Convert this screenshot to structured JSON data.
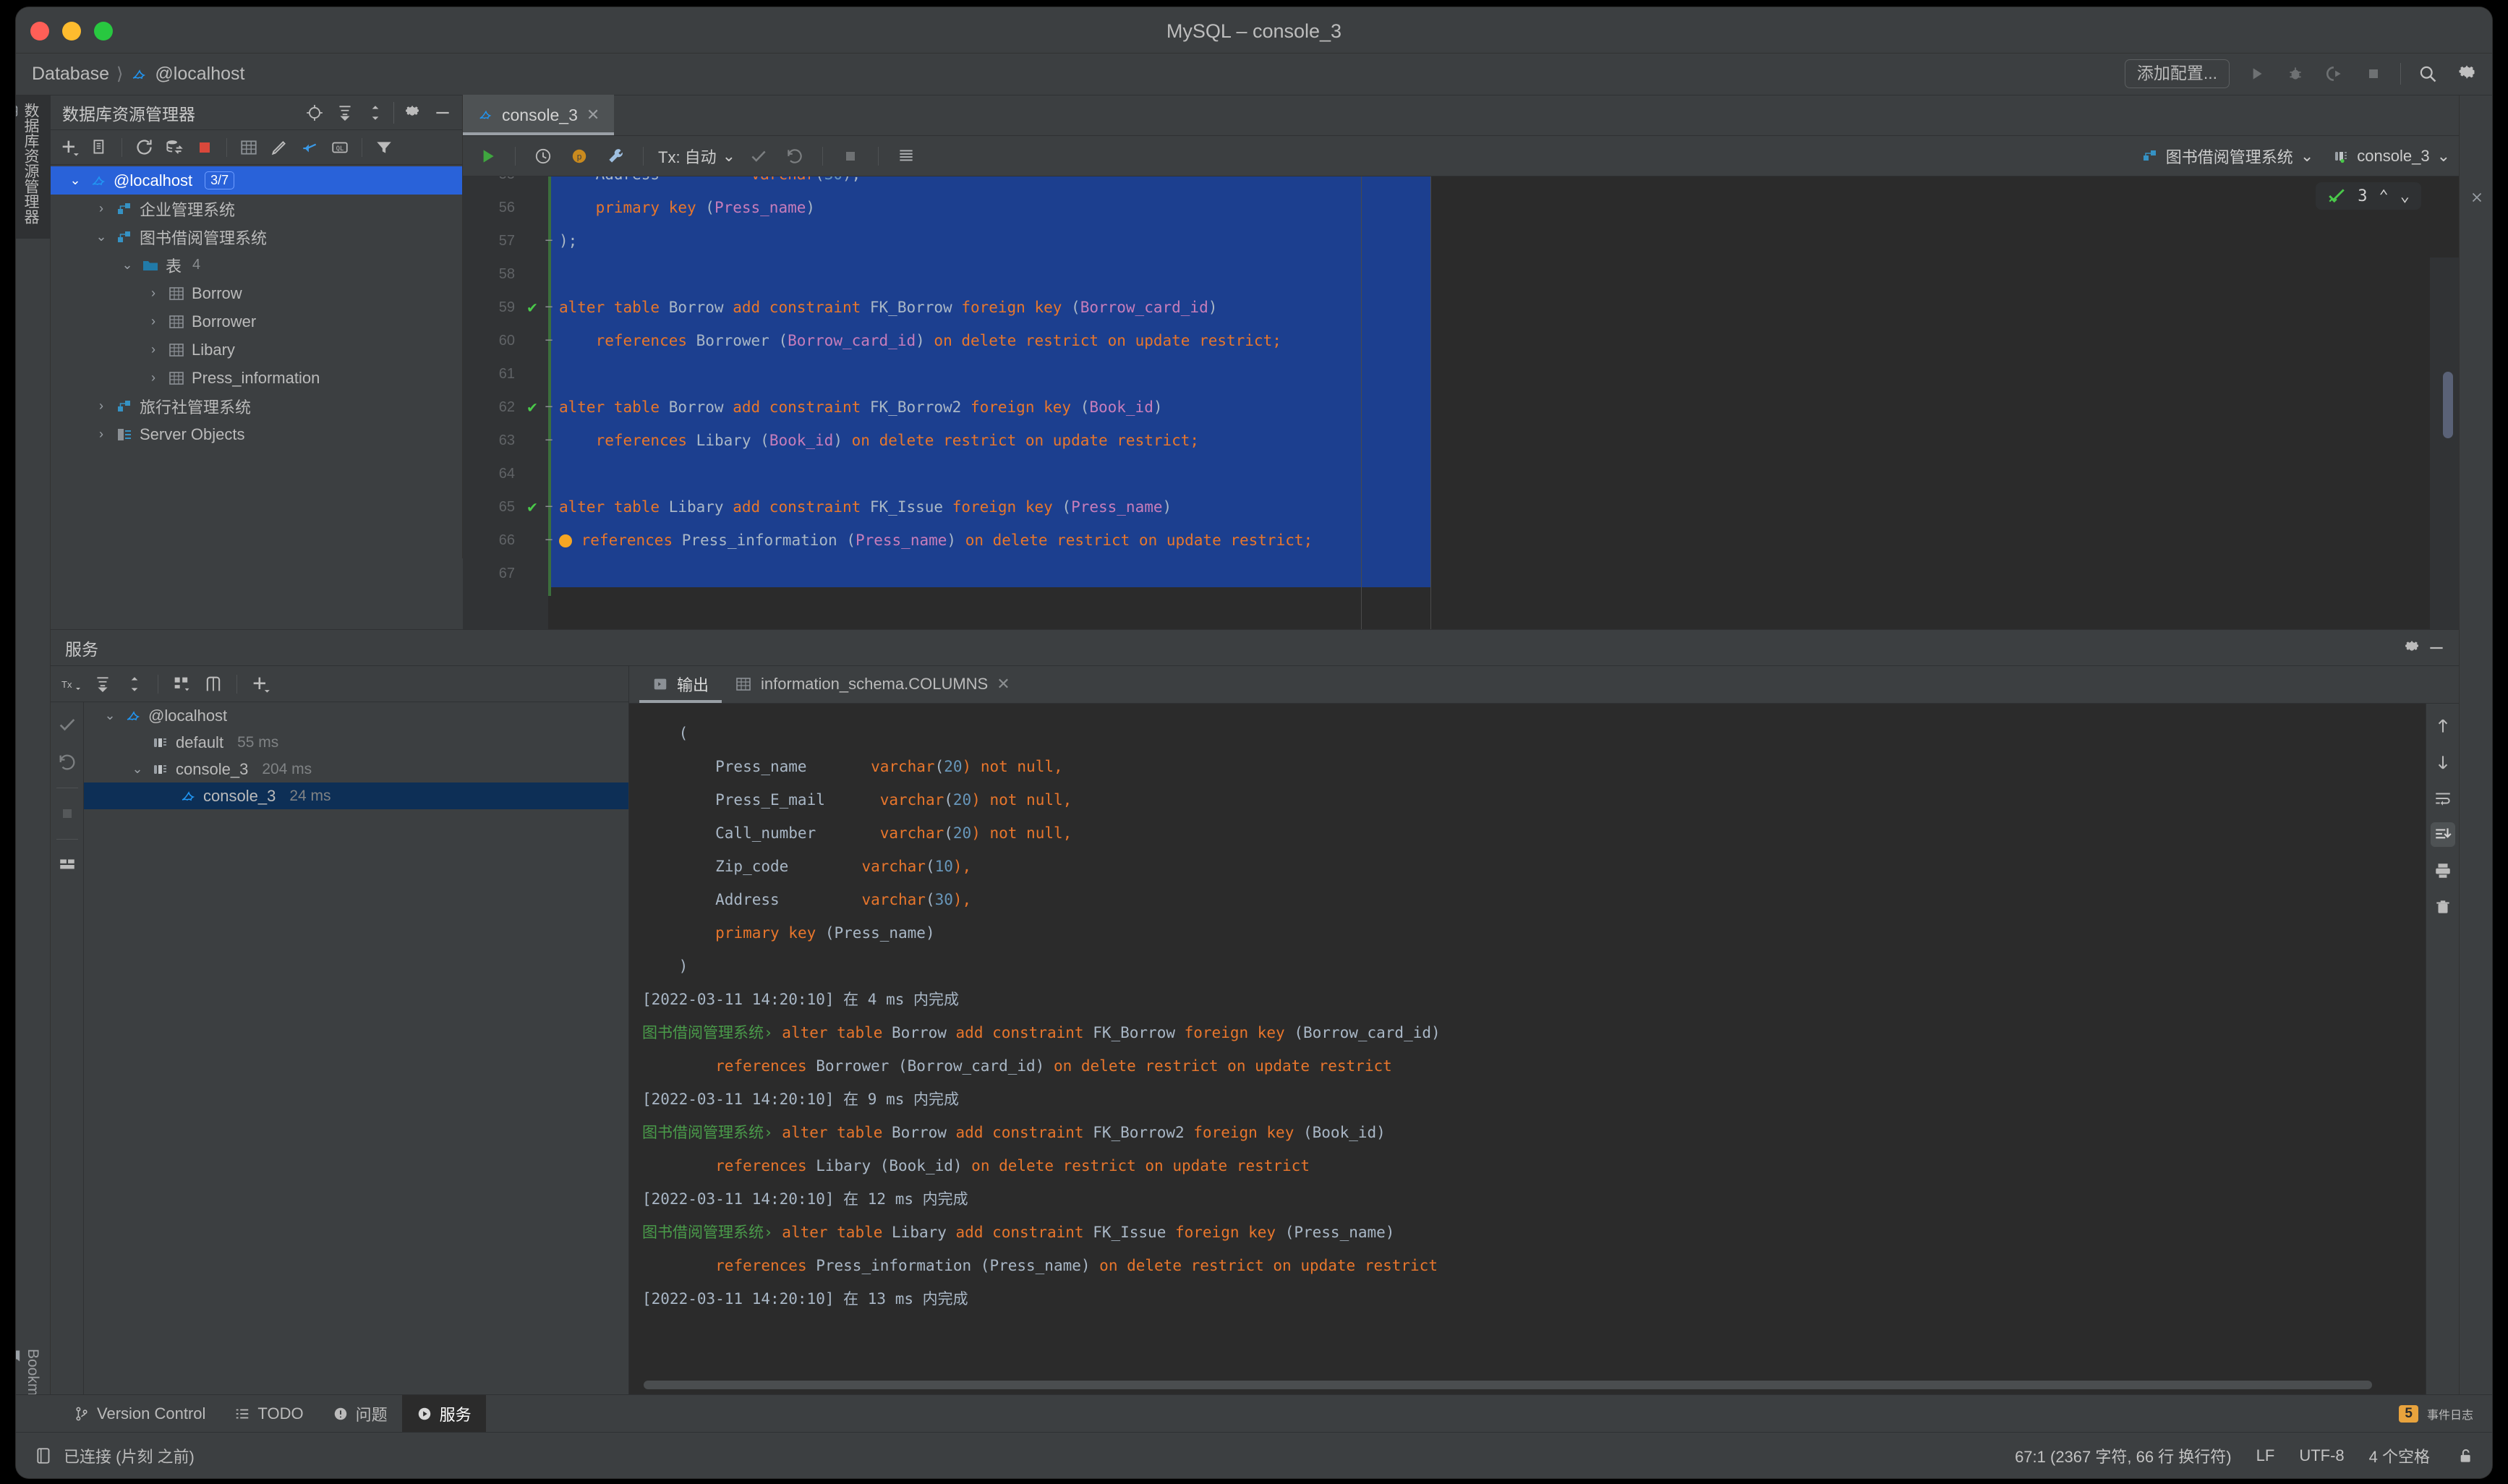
{
  "window": {
    "title": "MySQL – console_3",
    "traffic_lights": [
      "close",
      "minimize",
      "zoom"
    ]
  },
  "navbar": {
    "breadcrumb": [
      "Database",
      "@localhost"
    ],
    "add_config_label": "添加配置...",
    "icons": [
      "run-icon",
      "debug-icon",
      "run-with-coverage-icon",
      "stop-icon",
      "search-icon",
      "gear-icon"
    ]
  },
  "db_explorer": {
    "vertical_tab_label": "数据库资源管理器",
    "title": "数据库资源管理器",
    "header_icons": [
      "locate-icon",
      "expand-all-icon",
      "collapse-all-icon",
      "gear-icon",
      "minimize-icon"
    ],
    "toolbar_icons": [
      "add-icon",
      "copy-icon",
      "refresh-icon",
      "sync-icon",
      "stop-icon",
      "table-icon",
      "edit-icon",
      "jump-to-icon",
      "query-console-icon",
      "filter-icon"
    ],
    "tree": [
      {
        "label": "@localhost",
        "badge": "3/7",
        "icon": "mysql-icon",
        "level": 0,
        "expanded": true,
        "selected": true
      },
      {
        "label": "企业管理系统",
        "icon": "schema-icon",
        "level": 1,
        "expanded": false,
        "selected": false
      },
      {
        "label": "图书借阅管理系统",
        "icon": "schema-icon",
        "level": 1,
        "expanded": true,
        "selected": false
      },
      {
        "label": "表",
        "count": "4",
        "icon": "folder-icon",
        "level": 2,
        "expanded": true,
        "selected": false
      },
      {
        "label": "Borrow",
        "icon": "table-icon",
        "level": 3,
        "expanded": false,
        "selected": false
      },
      {
        "label": "Borrower",
        "icon": "table-icon",
        "level": 3,
        "expanded": false,
        "selected": false
      },
      {
        "label": "Libary",
        "icon": "table-icon",
        "level": 3,
        "expanded": false,
        "selected": false
      },
      {
        "label": "Press_information",
        "icon": "table-icon",
        "level": 3,
        "expanded": false,
        "selected": false
      },
      {
        "label": "旅行社管理系统",
        "icon": "schema-icon",
        "level": 1,
        "expanded": false,
        "selected": false
      },
      {
        "label": "Server Objects",
        "icon": "server-objects-icon",
        "level": 1,
        "expanded": false,
        "selected": false
      }
    ]
  },
  "editor": {
    "tab": {
      "label": "console_3",
      "icon": "mysql-icon",
      "close": "✕"
    },
    "toolbar": {
      "run_icon": "run-icon",
      "history_icon": "history-icon",
      "params_icon": "parameters-icon",
      "wrench_icon": "wrench-icon",
      "tx_label": "Tx: 自动",
      "commit_icon": "commit-icon",
      "rollback_icon": "rollback-icon",
      "stop_icon": "stop-icon",
      "grid_icon": "data-grid-icon",
      "schema_selector": "图书借阅管理系统",
      "session_selector": "console_3"
    },
    "inspection_widget": {
      "count": "3",
      "up": "⌃",
      "down": "⌄"
    },
    "lines": [
      {
        "num": "55",
        "partial": true,
        "mark": "",
        "fold": "",
        "tokens": [
          {
            "t": "    Address          ",
            "c": "id"
          },
          {
            "t": "varchar",
            "c": "kw"
          },
          {
            "t": "(",
            "c": "plain"
          },
          {
            "t": "30",
            "c": "num2"
          },
          {
            "t": "),",
            "c": "plain"
          }
        ]
      },
      {
        "num": "56",
        "mark": "",
        "fold": "",
        "tokens": [
          {
            "t": "    ",
            "c": "plain"
          },
          {
            "t": "primary key ",
            "c": "kw"
          },
          {
            "t": "(",
            "c": "plain"
          },
          {
            "t": "Press_name",
            "c": "col"
          },
          {
            "t": ")",
            "c": "plain"
          }
        ]
      },
      {
        "num": "57",
        "mark": "",
        "fold": "−",
        "tokens": [
          {
            "t": ");",
            "c": "plain"
          }
        ]
      },
      {
        "num": "58",
        "mark": "",
        "fold": "",
        "tokens": []
      },
      {
        "num": "59",
        "mark": "check",
        "fold": "−",
        "tokens": [
          {
            "t": "alter table ",
            "c": "kw"
          },
          {
            "t": "Borrow ",
            "c": "id"
          },
          {
            "t": "add constraint ",
            "c": "kw"
          },
          {
            "t": "FK_Borrow ",
            "c": "id"
          },
          {
            "t": "foreign key ",
            "c": "kw"
          },
          {
            "t": "(",
            "c": "plain"
          },
          {
            "t": "Borrow_card_id",
            "c": "col"
          },
          {
            "t": ")",
            "c": "plain"
          }
        ]
      },
      {
        "num": "60",
        "mark": "",
        "fold": "−",
        "tokens": [
          {
            "t": "    ",
            "c": "plain"
          },
          {
            "t": "references ",
            "c": "kw"
          },
          {
            "t": "Borrower ",
            "c": "id"
          },
          {
            "t": "(",
            "c": "plain"
          },
          {
            "t": "Borrow_card_id",
            "c": "col"
          },
          {
            "t": ") ",
            "c": "plain"
          },
          {
            "t": "on delete restrict on update restrict;",
            "c": "kw"
          }
        ]
      },
      {
        "num": "61",
        "mark": "",
        "fold": "",
        "tokens": []
      },
      {
        "num": "62",
        "mark": "check",
        "fold": "−",
        "tokens": [
          {
            "t": "alter table ",
            "c": "kw"
          },
          {
            "t": "Borrow ",
            "c": "id"
          },
          {
            "t": "add constraint ",
            "c": "kw"
          },
          {
            "t": "FK_Borrow2 ",
            "c": "id"
          },
          {
            "t": "foreign key ",
            "c": "kw"
          },
          {
            "t": "(",
            "c": "plain"
          },
          {
            "t": "Book_id",
            "c": "col"
          },
          {
            "t": ")",
            "c": "plain"
          }
        ]
      },
      {
        "num": "63",
        "mark": "",
        "fold": "−",
        "tokens": [
          {
            "t": "    ",
            "c": "plain"
          },
          {
            "t": "references ",
            "c": "kw"
          },
          {
            "t": "Libary ",
            "c": "id"
          },
          {
            "t": "(",
            "c": "plain"
          },
          {
            "t": "Book_id",
            "c": "col"
          },
          {
            "t": ") ",
            "c": "plain"
          },
          {
            "t": "on delete restrict on update restrict;",
            "c": "kw"
          }
        ]
      },
      {
        "num": "64",
        "mark": "",
        "fold": "",
        "tokens": []
      },
      {
        "num": "65",
        "mark": "check",
        "fold": "−",
        "tokens": [
          {
            "t": "alter table ",
            "c": "kw"
          },
          {
            "t": "Libary ",
            "c": "id"
          },
          {
            "t": "add constraint ",
            "c": "kw"
          },
          {
            "t": "FK_Issue ",
            "c": "id"
          },
          {
            "t": "foreign key ",
            "c": "kw"
          },
          {
            "t": "(",
            "c": "plain"
          },
          {
            "t": "Press_name",
            "c": "col"
          },
          {
            "t": ")",
            "c": "plain"
          }
        ]
      },
      {
        "num": "66",
        "mark": "bulb",
        "fold": "−",
        "tokens": [
          {
            "t": "references ",
            "c": "kw"
          },
          {
            "t": "Press_information ",
            "c": "id"
          },
          {
            "t": "(",
            "c": "plain"
          },
          {
            "t": "Press_name",
            "c": "col"
          },
          {
            "t": ") ",
            "c": "plain"
          },
          {
            "t": "on delete restrict on update restrict;",
            "c": "kw"
          }
        ]
      },
      {
        "num": "67",
        "mark": "",
        "fold": "",
        "tokens": []
      }
    ]
  },
  "services": {
    "title": "服务",
    "header_icons": [
      "gear-icon",
      "minimize-icon"
    ],
    "toolbar_icons": [
      "tx-icon",
      "expand-all-icon",
      "collapse-all-icon",
      "group-icon",
      "show-icon",
      "add-icon"
    ],
    "rail_icons": [
      "commit-icon",
      "rollback-icon",
      "stop-icon",
      "layout-icon"
    ],
    "tree": [
      {
        "label": "@localhost",
        "icon": "mysql-icon",
        "level": 0,
        "expanded": true,
        "selected": false,
        "time": ""
      },
      {
        "label": "default",
        "icon": "session-icon",
        "level": 1,
        "expanded": null,
        "selected": false,
        "time": "55 ms"
      },
      {
        "label": "console_3",
        "icon": "session-icon",
        "level": 1,
        "expanded": true,
        "selected": false,
        "time": "204 ms"
      },
      {
        "label": "console_3",
        "icon": "mysql-icon",
        "level": 2,
        "expanded": null,
        "selected": true,
        "time": "24 ms"
      }
    ]
  },
  "output": {
    "tabs": [
      {
        "label": "输出",
        "icon": "output-icon",
        "active": true,
        "closable": false
      },
      {
        "label": "information_schema.COLUMNS",
        "icon": "table-icon",
        "active": false,
        "closable": true
      }
    ],
    "rail_icons": [
      "scroll-up-icon",
      "scroll-down-icon",
      "soft-wrap-icon",
      "scroll-to-end-icon",
      "print-icon",
      "trash-icon"
    ],
    "lines": [
      {
        "tokens": [
          {
            "t": "    (",
            "c": "plain"
          }
        ]
      },
      {
        "tokens": [
          {
            "t": "        Press_name       ",
            "c": "plain"
          },
          {
            "t": "varchar",
            "c": "kw"
          },
          {
            "t": "(",
            "c": "plain"
          },
          {
            "t": "20",
            "c": "num2"
          },
          {
            "t": ") not null,",
            "c": "kw"
          }
        ]
      },
      {
        "tokens": [
          {
            "t": "        Press_E_mail      ",
            "c": "plain"
          },
          {
            "t": "varchar",
            "c": "kw"
          },
          {
            "t": "(",
            "c": "plain"
          },
          {
            "t": "20",
            "c": "num2"
          },
          {
            "t": ") not null,",
            "c": "kw"
          }
        ]
      },
      {
        "tokens": [
          {
            "t": "        Call_number       ",
            "c": "plain"
          },
          {
            "t": "varchar",
            "c": "kw"
          },
          {
            "t": "(",
            "c": "plain"
          },
          {
            "t": "20",
            "c": "num2"
          },
          {
            "t": ") not null,",
            "c": "kw"
          }
        ]
      },
      {
        "tokens": [
          {
            "t": "        Zip_code        ",
            "c": "plain"
          },
          {
            "t": "varchar",
            "c": "kw"
          },
          {
            "t": "(",
            "c": "plain"
          },
          {
            "t": "10",
            "c": "num2"
          },
          {
            "t": "),",
            "c": "kw"
          }
        ]
      },
      {
        "tokens": [
          {
            "t": "        Address         ",
            "c": "plain"
          },
          {
            "t": "varchar",
            "c": "kw"
          },
          {
            "t": "(",
            "c": "plain"
          },
          {
            "t": "30",
            "c": "num2"
          },
          {
            "t": "),",
            "c": "kw"
          }
        ]
      },
      {
        "tokens": [
          {
            "t": "        ",
            "c": "plain"
          },
          {
            "t": "primary key ",
            "c": "kw"
          },
          {
            "t": "(Press_name)",
            "c": "plain"
          }
        ]
      },
      {
        "tokens": [
          {
            "t": "    )",
            "c": "plain"
          }
        ]
      },
      {
        "tokens": [
          {
            "t": "[2022-03-11 14:20:10] 在 4 ms 内完成",
            "c": "ts"
          }
        ]
      },
      {
        "tokens": [
          {
            "t": "图书借阅管理系统›",
            "c": "schema"
          },
          {
            "t": " alter table ",
            "c": "kw"
          },
          {
            "t": "Borrow",
            "c": "plain"
          },
          {
            "t": " add constraint ",
            "c": "kw"
          },
          {
            "t": "FK_Borrow",
            "c": "plain"
          },
          {
            "t": " foreign key ",
            "c": "kw"
          },
          {
            "t": "(Borrow_card_id)",
            "c": "plain"
          }
        ]
      },
      {
        "tokens": [
          {
            "t": "        ",
            "c": "plain"
          },
          {
            "t": "references ",
            "c": "kw"
          },
          {
            "t": "Borrower (Borrow_card_id)",
            "c": "plain"
          },
          {
            "t": " on delete restrict on update restrict",
            "c": "kw"
          }
        ]
      },
      {
        "tokens": [
          {
            "t": "[2022-03-11 14:20:10] 在 9 ms 内完成",
            "c": "ts"
          }
        ]
      },
      {
        "tokens": [
          {
            "t": "图书借阅管理系统›",
            "c": "schema"
          },
          {
            "t": " alter table ",
            "c": "kw"
          },
          {
            "t": "Borrow",
            "c": "plain"
          },
          {
            "t": " add constraint ",
            "c": "kw"
          },
          {
            "t": "FK_Borrow2",
            "c": "plain"
          },
          {
            "t": " foreign key ",
            "c": "kw"
          },
          {
            "t": "(Book_id)",
            "c": "plain"
          }
        ]
      },
      {
        "tokens": [
          {
            "t": "        ",
            "c": "plain"
          },
          {
            "t": "references ",
            "c": "kw"
          },
          {
            "t": "Libary (Book_id)",
            "c": "plain"
          },
          {
            "t": " on delete restrict on update restrict",
            "c": "kw"
          }
        ]
      },
      {
        "tokens": [
          {
            "t": "[2022-03-11 14:20:10] 在 12 ms 内完成",
            "c": "ts"
          }
        ]
      },
      {
        "tokens": [
          {
            "t": "图书借阅管理系统›",
            "c": "schema"
          },
          {
            "t": " alter table ",
            "c": "kw"
          },
          {
            "t": "Libary",
            "c": "plain"
          },
          {
            "t": " add constraint ",
            "c": "kw"
          },
          {
            "t": "FK_Issue",
            "c": "plain"
          },
          {
            "t": " foreign key ",
            "c": "kw"
          },
          {
            "t": "(Press_name)",
            "c": "plain"
          }
        ]
      },
      {
        "tokens": [
          {
            "t": "        ",
            "c": "plain"
          },
          {
            "t": "references ",
            "c": "kw"
          },
          {
            "t": "Press_information (Press_name)",
            "c": "plain"
          },
          {
            "t": " on delete restrict on update restrict",
            "c": "kw"
          }
        ]
      },
      {
        "tokens": [
          {
            "t": "[2022-03-11 14:20:10] 在 13 ms 内完成",
            "c": "ts"
          }
        ]
      }
    ]
  },
  "tool_window_bar": {
    "tabs": [
      {
        "label": "Version Control",
        "icon": "branch-icon",
        "active": false
      },
      {
        "label": "TODO",
        "icon": "todo-icon",
        "active": false
      },
      {
        "label": "问题",
        "icon": "problems-icon",
        "active": false
      },
      {
        "label": "服务",
        "icon": "services-icon",
        "active": true
      }
    ],
    "event_log": {
      "label": "事件日志",
      "count": "5"
    },
    "bookmarks_label": "Bookmarks"
  },
  "statusbar": {
    "connection": "已连接 (片刻 之前)",
    "connection_icon": "db-icon",
    "caret": "67:1 (2367 字符, 66 行 换行符)",
    "line_sep": "LF",
    "encoding": "UTF-8",
    "indent": "4 个空格",
    "lock_icon": "unlocked-icon"
  },
  "colors": {
    "accent_blue": "#2962d9",
    "selection_blue": "#1c3f8f",
    "keyword_orange": "#e8762c",
    "identifier": "#a9b7c6",
    "column_pink": "#c77dbb",
    "number_blue": "#6897bb",
    "green_check": "#4ac94a",
    "schema_green": "#4a9c4a",
    "panel_bg": "#3c3f41",
    "editor_bg": "#2b2b2b"
  }
}
